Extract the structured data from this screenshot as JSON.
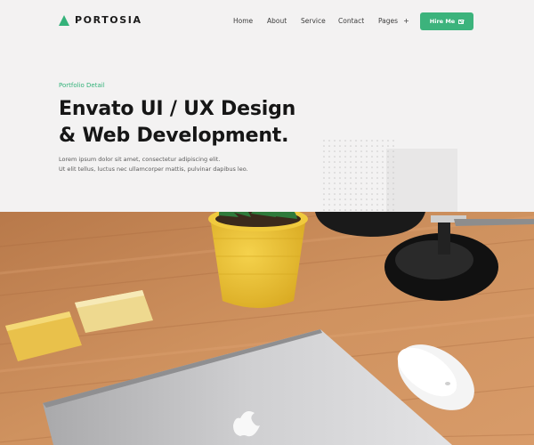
{
  "brand": {
    "name": "PORTOSIA",
    "accent": "#34b27a"
  },
  "nav": {
    "items": [
      {
        "label": "Home"
      },
      {
        "label": "About"
      },
      {
        "label": "Service"
      },
      {
        "label": "Contact"
      },
      {
        "label": "Pages",
        "suffix": "+"
      }
    ],
    "cta_label": "Hire Me",
    "cta_icon": "mail-icon"
  },
  "hero": {
    "eyebrow": "Portfolio Detail",
    "title_line1": "Envato UI / UX Design",
    "title_line2": "& Web Development.",
    "desc_line1": "Lorem ipsum dolor sit amet, consectetur adipiscing elit.",
    "desc_line2": "Ut elit tellus, luctus nec ullamcorper mattis, pulvinar dapibus leo."
  },
  "colors": {
    "background": "#f3f2f2",
    "wood": "#c98a58",
    "pot": "#e8c13a"
  }
}
